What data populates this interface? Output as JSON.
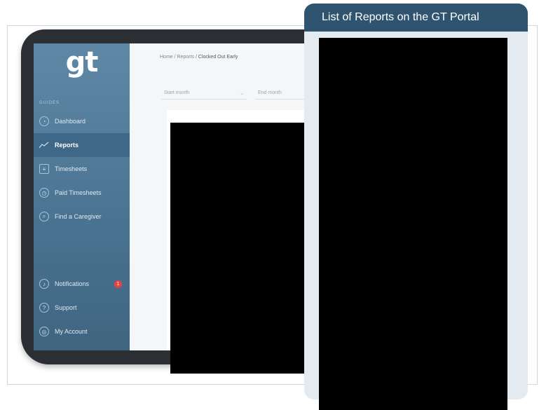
{
  "panel": {
    "title": "List of Reports on the GT Portal"
  },
  "tablet": {
    "logo": "gt",
    "sidebar": {
      "section_label": "GUIDES",
      "items": [
        {
          "label": "Dashboard",
          "icon": "dashboard-icon"
        },
        {
          "label": "Reports",
          "icon": "chart-icon",
          "active": true
        },
        {
          "label": "Timesheets",
          "icon": "timesheet-icon"
        },
        {
          "label": "Paid Timesheets",
          "icon": "clock-icon"
        },
        {
          "label": "Find a Caregiver",
          "icon": "search-icon"
        },
        {
          "label": "Notifications",
          "icon": "bell-icon",
          "badge": "1"
        },
        {
          "label": "Support",
          "icon": "support-icon"
        },
        {
          "label": "My Account",
          "icon": "account-icon"
        }
      ]
    },
    "breadcrumb": {
      "home": "Home",
      "section": "Reports",
      "current": "Clocked Out Early",
      "separator": "/"
    },
    "filters": [
      {
        "placeholder": "Start month"
      },
      {
        "placeholder": "End month"
      }
    ]
  },
  "colors": {
    "panel_header": "#2f5470",
    "panel_bg": "#e3ebf1",
    "sidebar": "#4b7493",
    "badge": "#e8433e",
    "redaction": "#000000"
  }
}
